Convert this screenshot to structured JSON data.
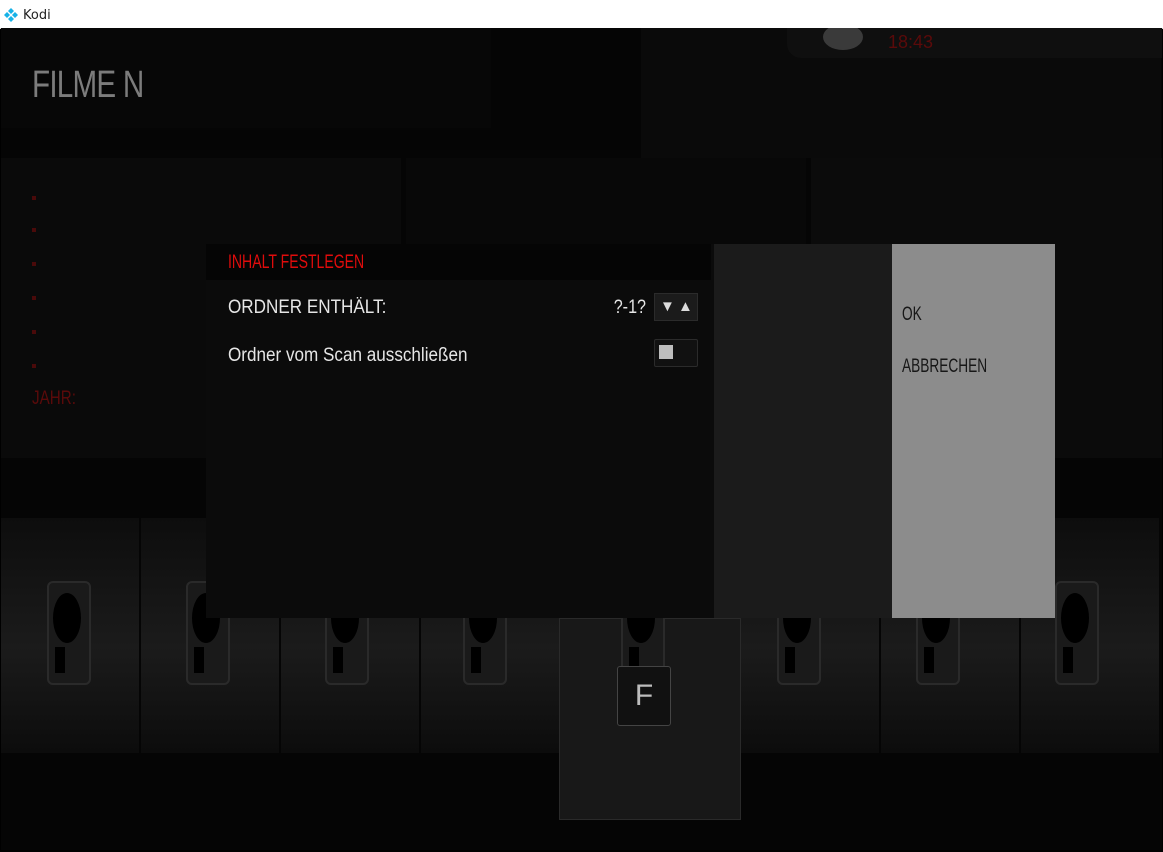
{
  "window": {
    "title": "Kodi"
  },
  "top": {
    "time": "18:43"
  },
  "page": {
    "title": "FILME N",
    "year_label": "JAHR:"
  },
  "dialog": {
    "title": "INHALT FESTLEGEN",
    "settings": [
      {
        "label": "ORDNER ENTHÄLT:",
        "value": "?-1?",
        "control": "spinner"
      },
      {
        "label": "Ordner vom Scan ausschließen",
        "value": "",
        "control": "toggle"
      }
    ],
    "spinner": {
      "down": "▼",
      "up": "▲"
    },
    "buttons": {
      "ok": "OK",
      "cancel": "ABBRECHEN"
    }
  },
  "selected_item": {
    "letter": "F"
  },
  "colors": {
    "accent": "#e00c0c",
    "panel": "#8c8c8c"
  }
}
